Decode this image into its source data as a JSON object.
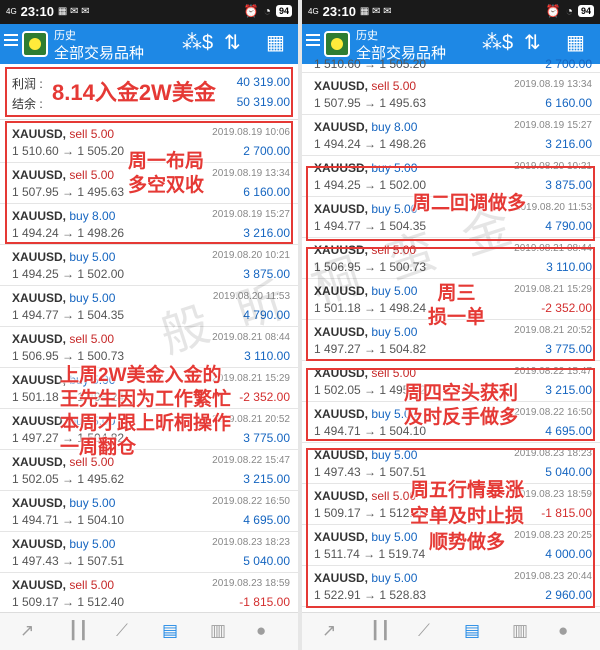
{
  "status": {
    "time": "23:10",
    "network": "4G",
    "battery": "94"
  },
  "app": {
    "subtitle": "历史",
    "title": "全部交易品种"
  },
  "balance": {
    "profit_label": "利润 :",
    "profit_value": "40 319.00",
    "balance_label": "结余 :",
    "balance_value": "50 319.00"
  },
  "left_trades": [
    {
      "symbol": "XAUUSD,",
      "action": "sell 5.00",
      "type": "sell",
      "prices": "1 510.60 → 1 505.20",
      "date": "2019.08.19 10:06",
      "profit": "2 700.00"
    },
    {
      "symbol": "XAUUSD,",
      "action": "sell 5.00",
      "type": "sell",
      "prices": "1 507.95 → 1 495.63",
      "date": "2019.08.19 13:34",
      "profit": "6 160.00"
    },
    {
      "symbol": "XAUUSD,",
      "action": "buy 8.00",
      "type": "buy",
      "prices": "1 494.24 → 1 498.26",
      "date": "2019.08.19 15:27",
      "profit": "3 216.00"
    },
    {
      "symbol": "XAUUSD,",
      "action": "buy 5.00",
      "type": "buy",
      "prices": "1 494.25 → 1 502.00",
      "date": "2019.08.20 10:21",
      "profit": "3 875.00"
    },
    {
      "symbol": "XAUUSD,",
      "action": "buy 5.00",
      "type": "buy",
      "prices": "1 494.77 → 1 504.35",
      "date": "2019.08.20 11:53",
      "profit": "4 790.00"
    },
    {
      "symbol": "XAUUSD,",
      "action": "sell 5.00",
      "type": "sell",
      "prices": "1 506.95 → 1 500.73",
      "date": "2019.08.21 08:44",
      "profit": "3 110.00"
    },
    {
      "symbol": "XAUUSD,",
      "action": "buy 5.00",
      "type": "buy",
      "prices": "1 501.18 → 1 498.24",
      "date": "2019.08.21 15:29",
      "profit": "-2 352.00"
    },
    {
      "symbol": "XAUUSD,",
      "action": "buy 5.00",
      "type": "buy",
      "prices": "1 497.27 → 1 504.82",
      "date": "2019.08.21 20:52",
      "profit": "3 775.00"
    },
    {
      "symbol": "XAUUSD,",
      "action": "sell 5.00",
      "type": "sell",
      "prices": "1 502.05 → 1 495.62",
      "date": "2019.08.22 15:47",
      "profit": "3 215.00"
    },
    {
      "symbol": "XAUUSD,",
      "action": "buy 5.00",
      "type": "buy",
      "prices": "1 494.71 → 1 504.10",
      "date": "2019.08.22 16:50",
      "profit": "4 695.00"
    },
    {
      "symbol": "XAUUSD,",
      "action": "buy 5.00",
      "type": "buy",
      "prices": "1 497.43 → 1 507.51",
      "date": "2019.08.23 18:23",
      "profit": "5 040.00"
    },
    {
      "symbol": "XAUUSD,",
      "action": "sell 5.00",
      "type": "sell",
      "prices": "1 509.17 → 1 512.40",
      "date": "2019.08.23 18:59",
      "profit": "-1 815.00"
    }
  ],
  "right_partial": {
    "prices": "1 510.60 → 1 505.20",
    "profit": "2 700.00"
  },
  "right_trades": [
    {
      "symbol": "XAUUSD,",
      "action": "sell 5.00",
      "type": "sell",
      "prices": "1 507.95 → 1 495.63",
      "date": "2019.08.19 13:34",
      "profit": "6 160.00"
    },
    {
      "symbol": "XAUUSD,",
      "action": "buy 8.00",
      "type": "buy",
      "prices": "1 494.24 → 1 498.26",
      "date": "2019.08.19 15:27",
      "profit": "3 216.00"
    },
    {
      "symbol": "XAUUSD,",
      "action": "buy 5.00",
      "type": "buy",
      "prices": "1 494.25 → 1 502.00",
      "date": "2019.08.20 10:21",
      "profit": "3 875.00"
    },
    {
      "symbol": "XAUUSD,",
      "action": "buy 5.00",
      "type": "buy",
      "prices": "1 494.77 → 1 504.35",
      "date": "2019.08.20 11:53",
      "profit": "4 790.00"
    },
    {
      "symbol": "XAUUSD,",
      "action": "sell 5.00",
      "type": "sell",
      "prices": "1 506.95 → 1 500.73",
      "date": "2019.08.21 08:44",
      "profit": "3 110.00"
    },
    {
      "symbol": "XAUUSD,",
      "action": "buy 5.00",
      "type": "buy",
      "prices": "1 501.18 → 1 498.24",
      "date": "2019.08.21 15:29",
      "profit": "-2 352.00"
    },
    {
      "symbol": "XAUUSD,",
      "action": "buy 5.00",
      "type": "buy",
      "prices": "1 497.27 → 1 504.82",
      "date": "2019.08.21 20:52",
      "profit": "3 775.00"
    },
    {
      "symbol": "XAUUSD,",
      "action": "sell 5.00",
      "type": "sell",
      "prices": "1 502.05 → 1 495.62",
      "date": "2019.08.22 15:47",
      "profit": "3 215.00"
    },
    {
      "symbol": "XAUUSD,",
      "action": "buy 5.00",
      "type": "buy",
      "prices": "1 494.71 → 1 504.10",
      "date": "2019.08.22 16:50",
      "profit": "4 695.00"
    },
    {
      "symbol": "XAUUSD,",
      "action": "buy 5.00",
      "type": "buy",
      "prices": "1 497.43 → 1 507.51",
      "date": "2019.08.23 18:23",
      "profit": "5 040.00"
    },
    {
      "symbol": "XAUUSD,",
      "action": "sell 5.00",
      "type": "sell",
      "prices": "1 509.17 → 1 512.40",
      "date": "2019.08.23 18:59",
      "profit": "-1 815.00"
    },
    {
      "symbol": "XAUUSD,",
      "action": "buy 5.00",
      "type": "buy",
      "prices": "1 511.74 → 1 519.74",
      "date": "2019.08.23 20:25",
      "profit": "4 000.00"
    },
    {
      "symbol": "XAUUSD,",
      "action": "buy 5.00",
      "type": "buy",
      "prices": "1 522.91 → 1 528.83",
      "date": "2019.08.23 20:44",
      "profit": "2 960.00"
    }
  ],
  "annotations": {
    "deposit": "8.14入金2W美金",
    "monday": "周一布局\n多空双收",
    "story": "上周2W美金入金的\n王先生因为工作繁忙\n本周才跟上昕桐操作\n一周翻仓",
    "tuesday": "周二回调做多",
    "wednesday": "周三\n损一单",
    "thursday": "周四空头获利\n及时反手做多",
    "friday": "周五行情暴涨\n空单及时止损\n顺势做多"
  },
  "watermark": "般 昕 桐 蛮 金",
  "colors": {
    "appbar": "#1e88e5",
    "sell": "#c62828",
    "buy": "#1565c0",
    "loss": "#d32f2f",
    "annotation": "#e53935"
  }
}
